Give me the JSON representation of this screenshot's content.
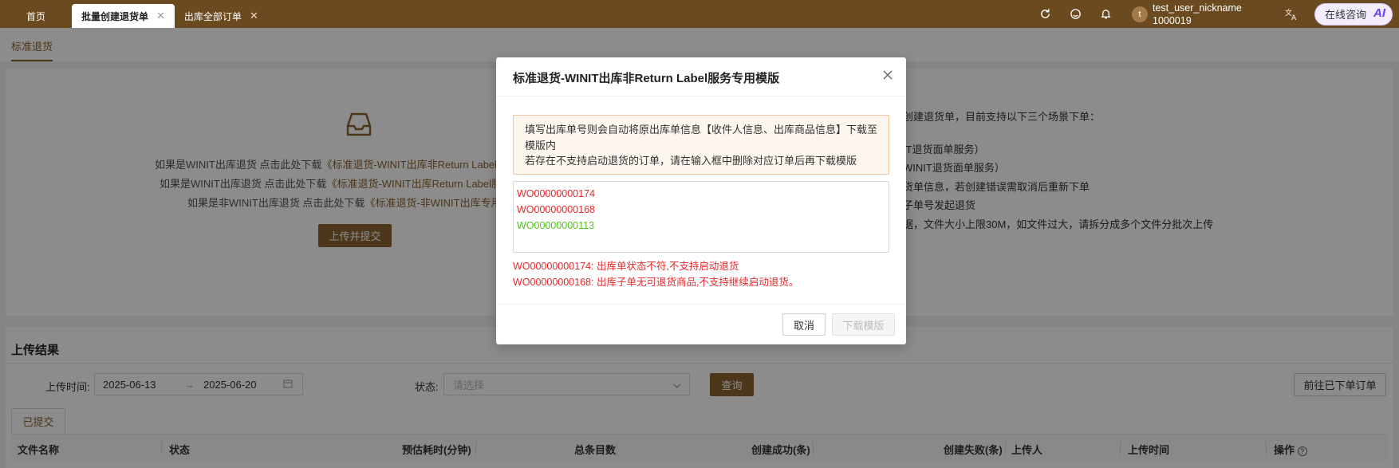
{
  "tabs": [
    {
      "label": "首页"
    },
    {
      "label": "批量创建退货单"
    },
    {
      "label": "出库全部订单"
    }
  ],
  "user": {
    "avatar_letter": "t",
    "nickname": "test_user_nickname",
    "id": "1000019"
  },
  "consult": {
    "label": "在线咨询",
    "ai": "AI"
  },
  "subnav": {
    "tab": "标准退货"
  },
  "upload": {
    "links": [
      {
        "prefix": "如果是WINIT出库退货 点击此处下载",
        "link": "《标准退货-WINIT出库非Return Label服务"
      },
      {
        "prefix": "如果是WINIT出库退货 点击此处下载",
        "link": "《标准退货-WINIT出库Return Label服务"
      },
      {
        "prefix": "如果是非WINIT出库退货 点击此处下载",
        "link": "《标准退货-非WINIT出库专用模"
      }
    ],
    "button": "上传并提交"
  },
  "rules": [
    "创建退货单，目前支持以下三个场景下单：",
    "IT退货面单服务）",
    "WINIT退货面单服务）",
    "货单信息，若创建错误需取消后重新下单",
    "子单号发起退货",
    "据，文件大小上限30M，如文件过大，请拆分成多个文件分批次上传"
  ],
  "results": {
    "title": "上传结果",
    "upload_time_label": "上传时间:",
    "date_start": "2025-06-13",
    "date_end": "2025-06-20",
    "status_label": "状态:",
    "status_placeholder": "请选择",
    "query": "查询",
    "goto": "前往已下单订单",
    "subtab": "已提交",
    "columns": [
      "文件名称",
      "状态",
      "预估耗时(分钟)",
      "总条目数",
      "创建成功(条)",
      "创建失败(条)",
      "上传人",
      "上传时间",
      "操作"
    ]
  },
  "modal": {
    "title": "标准退货-WINIT出库非Return Label服务专用模版",
    "notice_line1": "填写出库单号则会自动将原出库单信息【收件人信息、出库商品信息】下载至模版内",
    "notice_line2": "若存在不支持启动退货的订单，请在输入框中删除对应订单后再下载模版",
    "orders": [
      {
        "no": "WO00000000174",
        "color": "#e6282b"
      },
      {
        "no": "WO00000000168",
        "color": "#e6282b"
      },
      {
        "no": "WO00000000113",
        "color": "#52c41a"
      }
    ],
    "errors": [
      "WO00000000174: 出库单状态不符,不支持启动退货",
      "WO00000000168: 出库子单无可退货商品,不支持继续启动退货。"
    ],
    "cancel": "取消",
    "download": "下载模版"
  }
}
